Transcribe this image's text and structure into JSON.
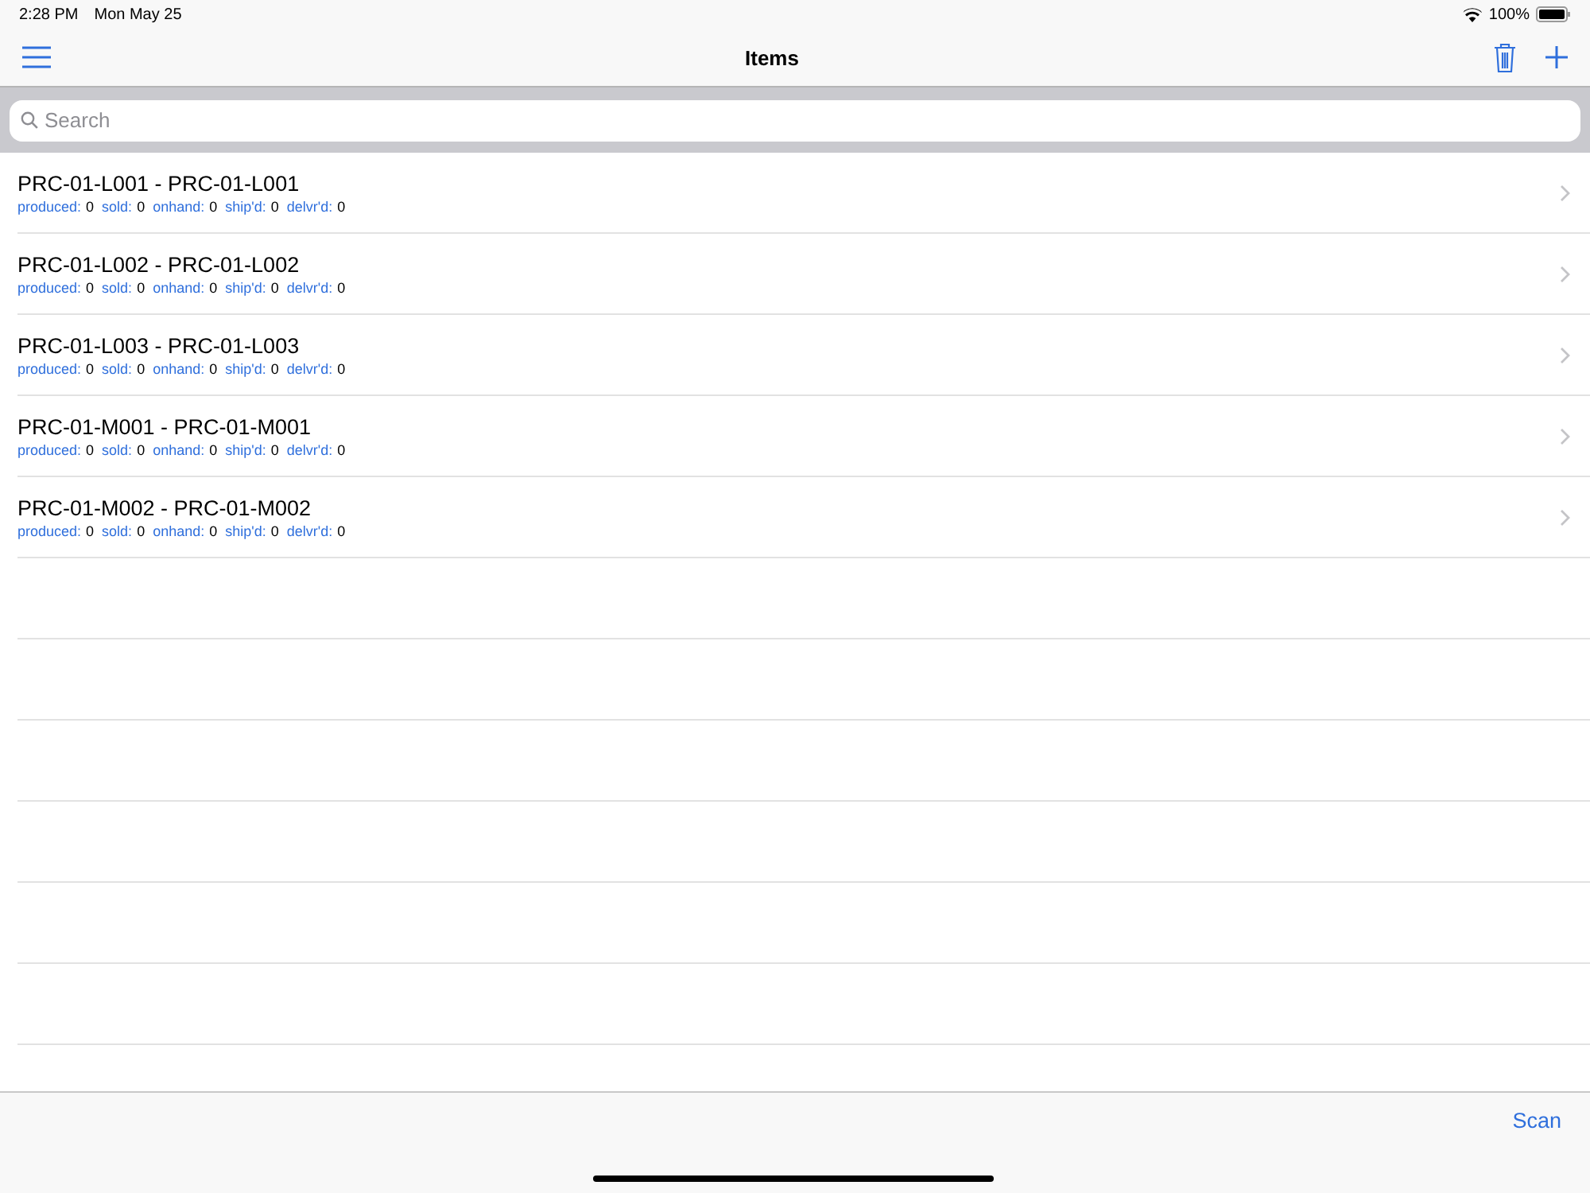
{
  "status_bar": {
    "time": "2:28 PM",
    "date": "Mon May 25",
    "battery": "100%"
  },
  "nav": {
    "title": "Items"
  },
  "search": {
    "placeholder": "Search"
  },
  "items": [
    {
      "title": "PRC-01-L001 - PRC-01-L001",
      "stats": [
        {
          "label": "produced:",
          "value": "0"
        },
        {
          "label": "sold:",
          "value": "0"
        },
        {
          "label": "onhand:",
          "value": "0"
        },
        {
          "label": "ship'd:",
          "value": "0"
        },
        {
          "label": "delvr'd:",
          "value": "0"
        }
      ]
    },
    {
      "title": "PRC-01-L002 - PRC-01-L002",
      "stats": [
        {
          "label": "produced:",
          "value": "0"
        },
        {
          "label": "sold:",
          "value": "0"
        },
        {
          "label": "onhand:",
          "value": "0"
        },
        {
          "label": "ship'd:",
          "value": "0"
        },
        {
          "label": "delvr'd:",
          "value": "0"
        }
      ]
    },
    {
      "title": "PRC-01-L003 - PRC-01-L003",
      "stats": [
        {
          "label": "produced:",
          "value": "0"
        },
        {
          "label": "sold:",
          "value": "0"
        },
        {
          "label": "onhand:",
          "value": "0"
        },
        {
          "label": "ship'd:",
          "value": "0"
        },
        {
          "label": "delvr'd:",
          "value": "0"
        }
      ]
    },
    {
      "title": "PRC-01-M001 - PRC-01-M001",
      "stats": [
        {
          "label": "produced:",
          "value": "0"
        },
        {
          "label": "sold:",
          "value": "0"
        },
        {
          "label": "onhand:",
          "value": "0"
        },
        {
          "label": "ship'd:",
          "value": "0"
        },
        {
          "label": "delvr'd:",
          "value": "0"
        }
      ]
    },
    {
      "title": "PRC-01-M002 - PRC-01-M002",
      "stats": [
        {
          "label": "produced:",
          "value": "0"
        },
        {
          "label": "sold:",
          "value": "0"
        },
        {
          "label": "onhand:",
          "value": "0"
        },
        {
          "label": "ship'd:",
          "value": "0"
        },
        {
          "label": "delvr'd:",
          "value": "0"
        }
      ]
    }
  ],
  "toolbar": {
    "scan": "Scan"
  }
}
